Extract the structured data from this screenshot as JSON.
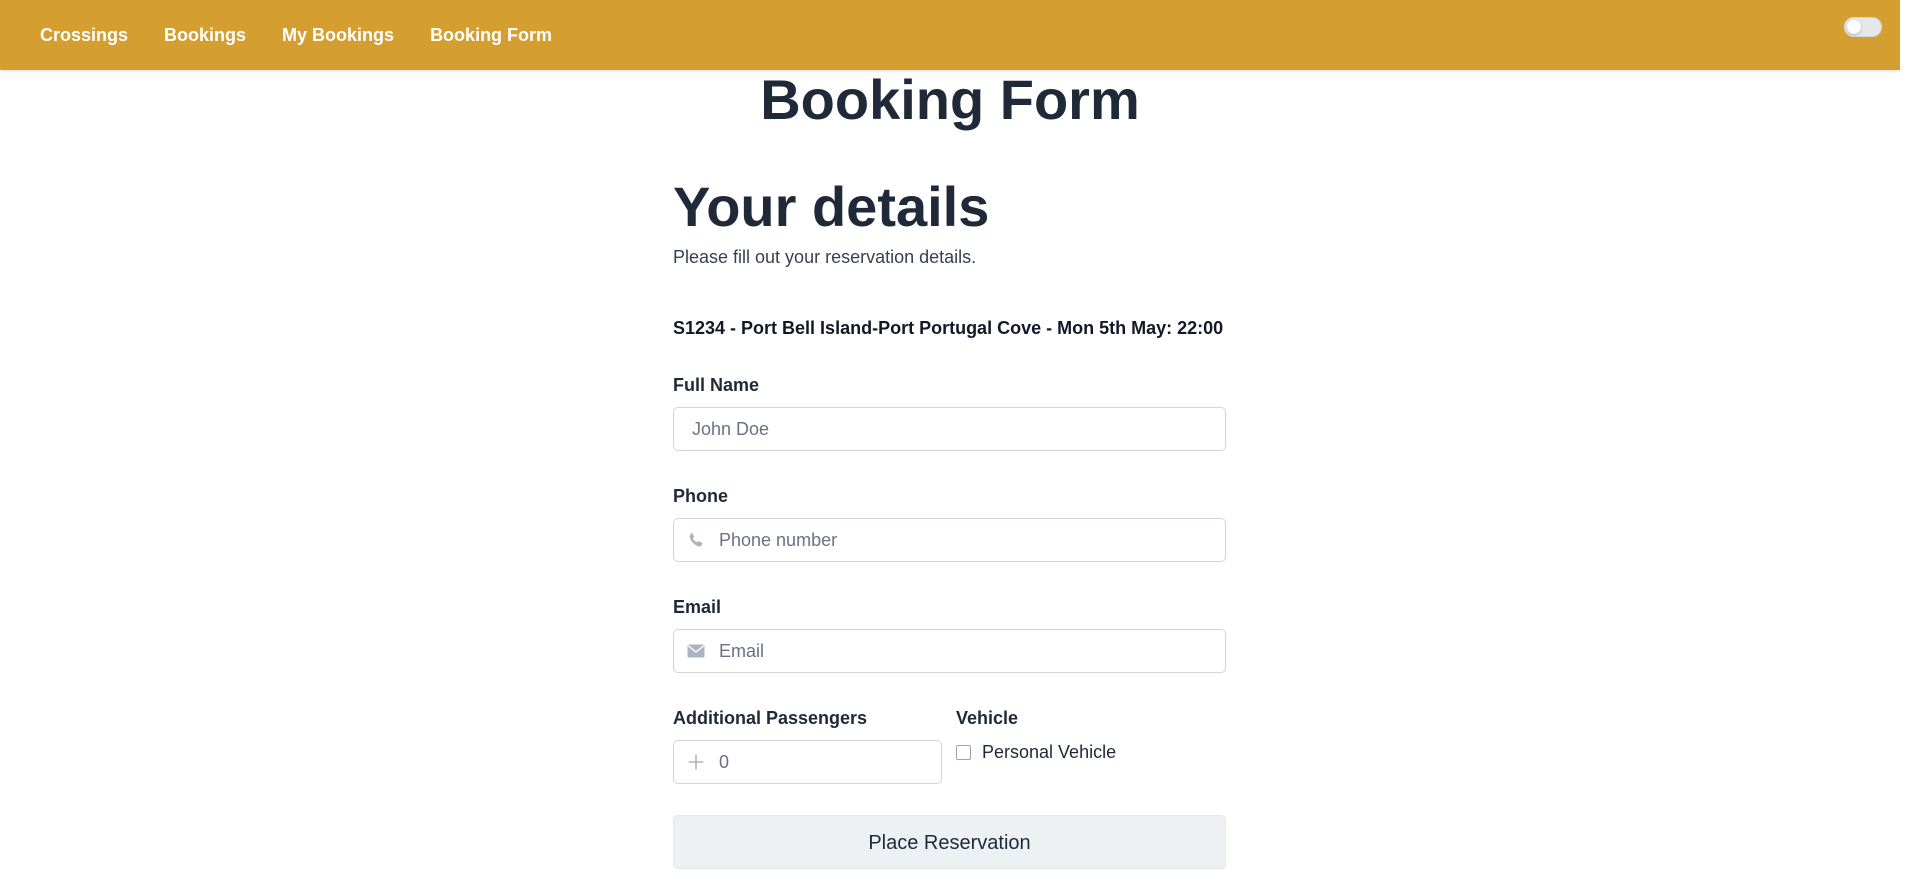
{
  "nav": {
    "links": [
      "Crossings",
      "Bookings",
      "My Bookings",
      "Booking Form"
    ],
    "theme_toggle_on": false
  },
  "page": {
    "title": "Booking Form"
  },
  "form": {
    "section_title": "Your details",
    "subtitle": "Please fill out your reservation details.",
    "crossing": "S1234 - Port Bell Island-Port Portugal Cove - Mon 5th May: 22:00",
    "full_name": {
      "label": "Full Name",
      "placeholder": "John Doe",
      "value": ""
    },
    "phone": {
      "label": "Phone",
      "placeholder": "Phone number",
      "value": "",
      "icon": "phone-icon"
    },
    "email": {
      "label": "Email",
      "placeholder": "Email",
      "value": "",
      "icon": "envelope-icon"
    },
    "passengers": {
      "label": "Additional Passengers",
      "placeholder": "0",
      "value": "",
      "icon": "plus-icon"
    },
    "vehicle": {
      "label": "Vehicle",
      "option_label": "Personal Vehicle",
      "checked": false
    },
    "submit_label": "Place Reservation"
  },
  "colors": {
    "navbar": "#d49e31",
    "text": "#1f2937",
    "button_bg": "#eef1f4"
  }
}
